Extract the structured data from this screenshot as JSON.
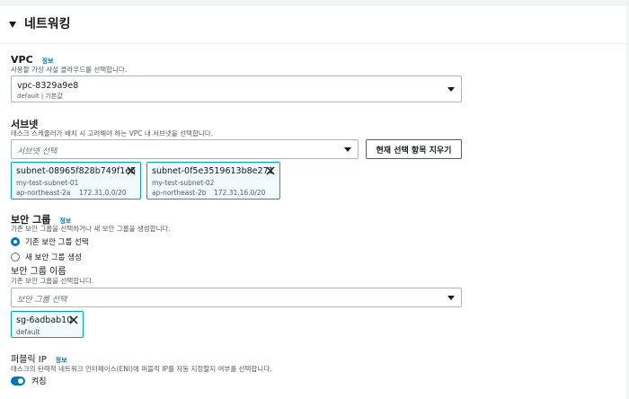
{
  "section": {
    "title": "네트워킹"
  },
  "vpc": {
    "label": "VPC",
    "info": "정보",
    "description": "사용할 가상 사설 클라우드를 선택합니다.",
    "selected_value": "vpc-8329a9e8",
    "selected_sub": "default | 기본값"
  },
  "subnet": {
    "label": "서브넷",
    "description": "태스크 스케줄러가 배치 시 고려해야 하는 VPC 내 서브넷을 선택합니다.",
    "placeholder": "서브넷 선택",
    "clear_button": "현재 선택 항목 지우기",
    "tokens": [
      {
        "id": "subnet-08965f828b749f1e5",
        "name": "my-test-subnet-01",
        "az": "ap-northeast-2a",
        "cidr": "172.31.0.0/20"
      },
      {
        "id": "subnet-0f5e3519613b8e271",
        "name": "my-test-subnet-02",
        "az": "ap-northeast-2b",
        "cidr": "172.31.16.0/20"
      }
    ]
  },
  "security_group": {
    "label": "보안 그룹",
    "info": "정보",
    "description": "기존 보안 그룹을 선택하거나 새 보안 그룹을 생성합니다.",
    "options": [
      {
        "label": "기존 보안 그룹 선택",
        "checked": true
      },
      {
        "label": "새 보안 그룹 생성",
        "checked": false
      }
    ],
    "name_label": "보안 그룹 이름",
    "name_description": "기존 보안 그룹을 선택합니다.",
    "placeholder": "보안 그룹 선택",
    "tokens": [
      {
        "id": "sg-6adbab10",
        "name": "default"
      }
    ]
  },
  "public_ip": {
    "label": "퍼블릭 IP",
    "info": "정보",
    "description": "태스크의 탄력적 네트워크 인터페이스(ENI)에 퍼블릭 IP를 자동 지정할지 여부를 선택합니다.",
    "toggle_label": "켜짐",
    "enabled": true
  },
  "colors": {
    "accent": "#0073bb",
    "token_border": "#00a1c9",
    "token_bg": "#f1faff"
  }
}
